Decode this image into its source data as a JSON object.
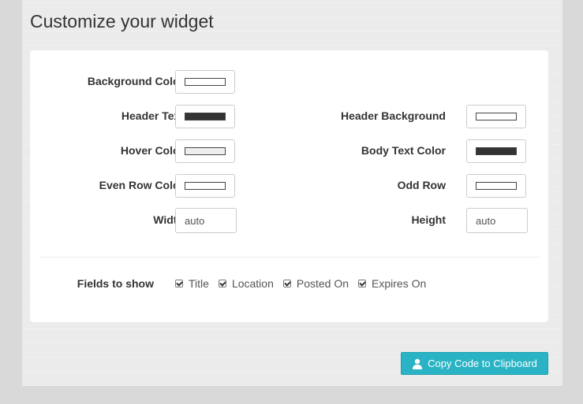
{
  "page": {
    "title": "Customize your widget"
  },
  "colors": {
    "accent": "#2ab3c4",
    "background_color": "#ffffff",
    "header_text": "#333333",
    "header_background": "#ffffff",
    "hover_color": "#eeeeee",
    "body_text_color": "#333333",
    "even_row_color": "#ffffff",
    "odd_row": "#ffffff"
  },
  "form": {
    "background_color_label": "Background Color",
    "header_text_label": "Header Text",
    "header_background_label": "Header Background",
    "hover_color_label": "Hover Color",
    "body_text_color_label": "Body Text Color",
    "even_row_color_label": "Even Row Color",
    "odd_row_label": "Odd Row",
    "width_label": "Width",
    "width_value": "auto",
    "height_label": "Height",
    "height_value": "auto",
    "fields_label": "Fields to show",
    "fields": [
      {
        "label": "Title",
        "checked": true
      },
      {
        "label": "Location",
        "checked": true
      },
      {
        "label": "Posted On",
        "checked": true
      },
      {
        "label": "Expires On",
        "checked": true
      }
    ]
  },
  "actions": {
    "copy_label": "Copy Code to Clipboard",
    "copy_icon": "user-icon"
  }
}
